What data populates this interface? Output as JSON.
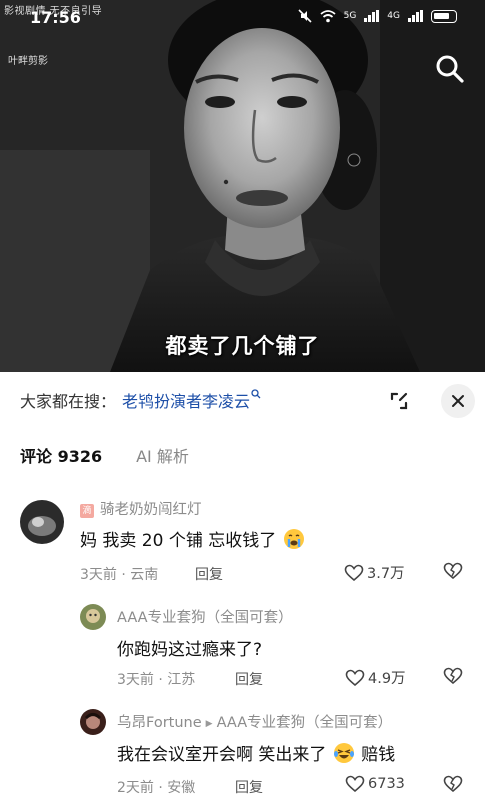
{
  "status_bar": {
    "time": "17:56",
    "network_1": "5G",
    "network_2": "4G"
  },
  "watermark": {
    "top_text": "影视剧情 无不良引导",
    "channel_text": "叶畔剪影"
  },
  "video": {
    "subtitle": "都卖了几个铺了"
  },
  "trending": {
    "label": "大家都在搜：",
    "query": "老鸨扮演者李凌云"
  },
  "tabs": [
    {
      "label": "评论 9326"
    },
    {
      "label": "AI 解析"
    }
  ],
  "comments": [
    {
      "username": "骑老奶奶闯红灯",
      "badge": "滴",
      "text": "妈 我卖 20 个铺 忘收钱了",
      "time": "3天前",
      "location": "云南",
      "reply_label": "回复",
      "likes": "3.7万"
    },
    {
      "username": "AAA专业套狗（全国可套）",
      "text": "你跑妈这过瘾来了?",
      "time": "3天前",
      "location": "江苏",
      "reply_label": "回复",
      "likes": "4.9万"
    },
    {
      "username": "乌昂Fortune",
      "reply_to": "AAA专业套狗（全国可套）",
      "text_before": "我在会议室开会啊  笑出来了",
      "text_after": "赔钱",
      "time": "2天前",
      "location": "安徽",
      "reply_label": "回复",
      "likes": "6733"
    }
  ],
  "colors": {
    "accent": "#1d4fa8",
    "muted": "#8c8c8c"
  }
}
